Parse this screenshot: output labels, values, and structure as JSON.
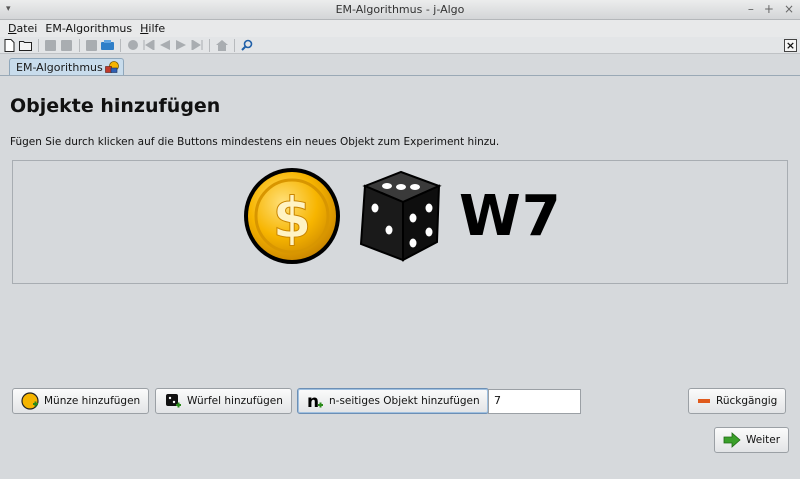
{
  "window": {
    "title": "EM-Algorithmus  - j-Algo"
  },
  "menu": {
    "items": [
      {
        "label": "Datei",
        "u": "D"
      },
      {
        "label": "EM-Algorithmus",
        "u": ""
      },
      {
        "label": "Hilfe",
        "u": "H"
      }
    ]
  },
  "toolbar": {
    "icons": [
      "new-file-icon",
      "open-folder-icon",
      "save-icon",
      "save-as-icon",
      "print-icon",
      "export-icon",
      "record-icon",
      "first-icon",
      "back-icon",
      "forward-icon",
      "last-icon",
      "home-icon",
      "search-icon"
    ]
  },
  "tab": {
    "label": "EM-Algorithmus"
  },
  "main": {
    "title": "Objekte hinzufügen",
    "description": "Fügen Sie durch klicken auf die Buttons mindestens ein neues Objekt zum Experiment hinzu.",
    "object_label": "W7"
  },
  "buttons": {
    "coin": "Münze hinzufügen",
    "dice": "Würfel hinzufügen",
    "nsided": "n-seitiges Objekt hinzufügen",
    "undo": "Rückgängig",
    "next": "Weiter"
  },
  "sides_input": {
    "value": "7"
  },
  "colors": {
    "coin": "#f5b400",
    "tab": "#c8dcec",
    "next_arrow": "#3aa02a",
    "undo_bar": "#e05a1c"
  }
}
